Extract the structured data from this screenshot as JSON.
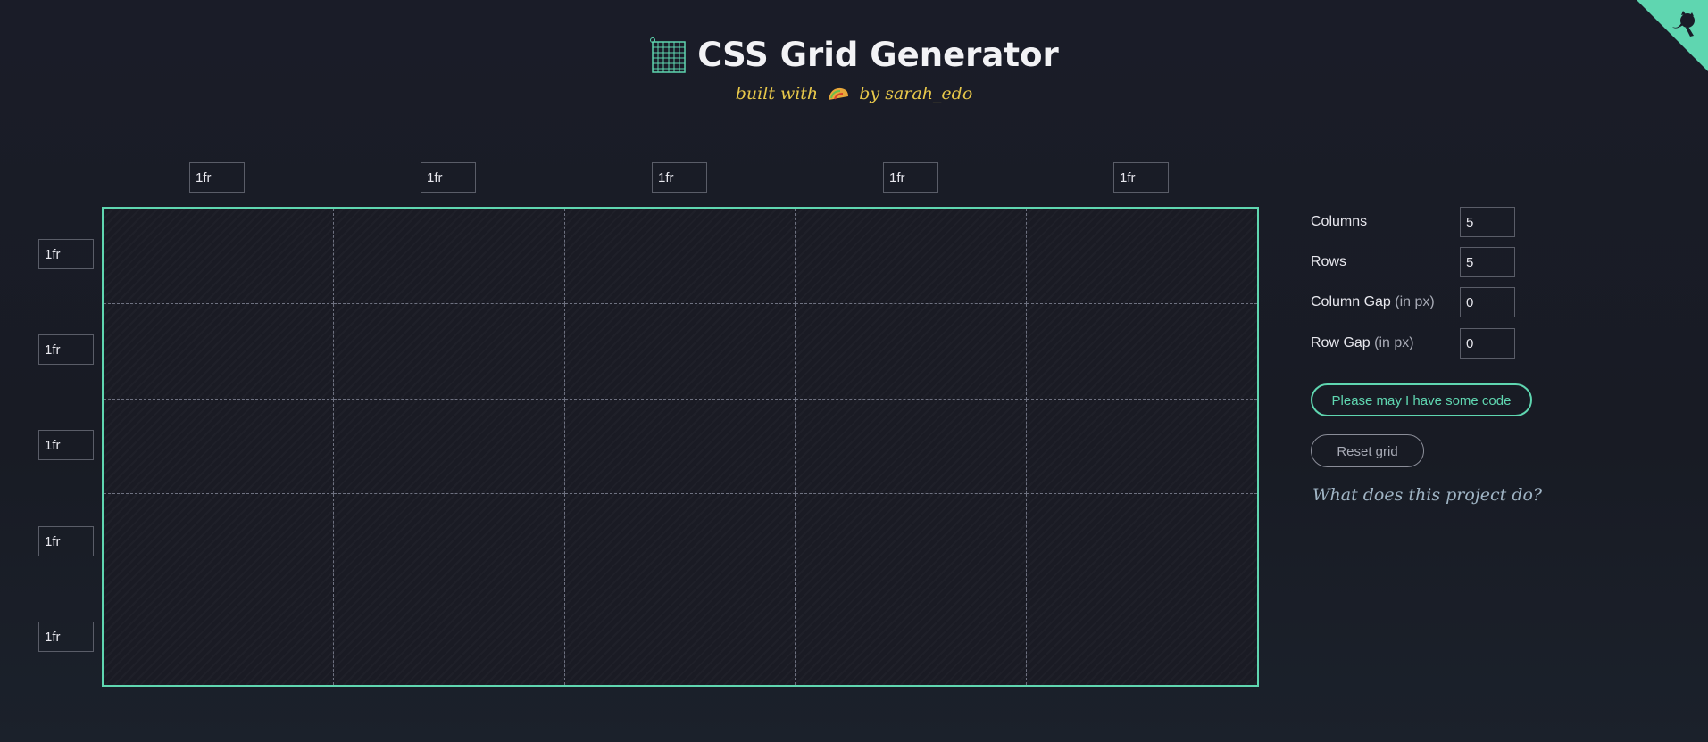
{
  "header": {
    "title": "CSS Grid Generator",
    "subtitle_prefix": "built with",
    "subtitle_suffix": "by sarah_edo",
    "logo_icon": "grid-icon",
    "taco_icon": "taco-icon"
  },
  "corner": {
    "icon": "github-octocat-icon",
    "color": "#5fd6b0"
  },
  "grid": {
    "columns": [
      "1fr",
      "1fr",
      "1fr",
      "1fr",
      "1fr"
    ],
    "rows": [
      "1fr",
      "1fr",
      "1fr",
      "1fr",
      "1fr"
    ],
    "border_color": "#5fd6b0"
  },
  "settings": {
    "columns_label": "Columns",
    "columns_value": "5",
    "rows_label": "Rows",
    "rows_value": "5",
    "column_gap_label": "Column Gap",
    "column_gap_unit": "(in px)",
    "column_gap_value": "0",
    "row_gap_label": "Row Gap",
    "row_gap_unit": "(in px)",
    "row_gap_value": "0"
  },
  "actions": {
    "code_button": "Please may I have some code",
    "reset_button": "Reset grid",
    "help_link": "What does this project do?"
  }
}
